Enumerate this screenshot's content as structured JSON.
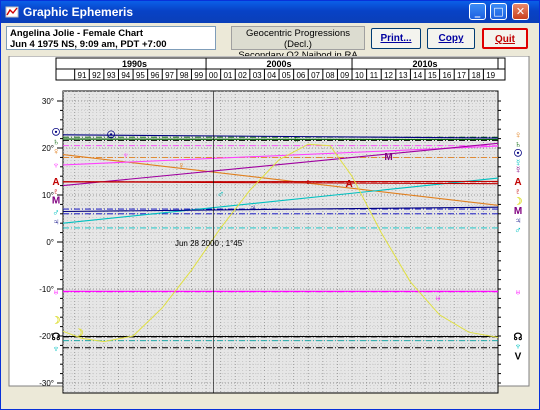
{
  "window": {
    "title": "Graphic Ephemeris"
  },
  "chart_info": {
    "line1": "Angelina Jolie - Female Chart",
    "line2": "Jun 4 1975 NS, 9:09 am, PDT +7:00"
  },
  "method": {
    "line1": "Geocentric Progressions (Decl.)",
    "line2": "Secondary Q2 Naibod in RA"
  },
  "buttons": {
    "print": "Print...",
    "copy": "Copy",
    "quit": "Quit"
  },
  "nav": {
    "prev": "<<",
    "next": ">>"
  },
  "decades": [
    "1990s",
    "2000s",
    "2010s"
  ],
  "years": [
    "91",
    "92",
    "93",
    "94",
    "95",
    "96",
    "97",
    "98",
    "99",
    "00",
    "01",
    "02",
    "03",
    "04",
    "05",
    "06",
    "07",
    "08",
    "09",
    "10",
    "11",
    "12",
    "13",
    "14",
    "15",
    "16",
    "17",
    "18",
    "19"
  ],
  "y_ticks": [
    "30°",
    "20°",
    "10°",
    "0°",
    "-10°",
    "-20°",
    "-30°"
  ],
  "cursor_label": "Jun 28 2000 ;  1°45'",
  "chart_data": {
    "type": "line",
    "ylim": [
      -30,
      30
    ],
    "x_range": [
      1990.2,
      2020.0
    ],
    "series": [
      {
        "name": "Sun",
        "color": "#000080",
        "points": [
          [
            1990.2,
            22.8
          ],
          [
            2020,
            22.1
          ]
        ]
      },
      {
        "name": "Saturn",
        "color": "#006000",
        "points": [
          [
            1990.2,
            21.9
          ],
          [
            2020,
            21.8
          ]
        ]
      },
      {
        "name": "Venus",
        "color": "#e08020",
        "points": [
          [
            1990.2,
            18.6
          ],
          [
            2020,
            7.8
          ]
        ]
      },
      {
        "name": "Neptune",
        "color": "#ff40ff",
        "points": [
          [
            1990.2,
            16.4
          ],
          [
            2020,
            20.4
          ]
        ]
      },
      {
        "name": "Mercury",
        "color": "#a000a0",
        "points": [
          [
            1990.2,
            12.0
          ],
          [
            2020,
            21.0
          ]
        ]
      },
      {
        "name": "Mars",
        "color": "#00c0c0",
        "points": [
          [
            1990.2,
            4.0
          ],
          [
            2020,
            13.6
          ]
        ]
      },
      {
        "name": "Ascendant",
        "color": "#c00000",
        "points": [
          [
            1990.2,
            12.8
          ],
          [
            2020,
            12.4
          ]
        ]
      },
      {
        "name": "Pluto",
        "color": "#c00000",
        "points": [
          [
            1990.2,
            12.8
          ],
          [
            2020,
            12.9
          ]
        ]
      },
      {
        "name": "Jupiter",
        "color": "#000080",
        "points": [
          [
            1990.2,
            6.5
          ],
          [
            2020,
            7.4
          ]
        ]
      },
      {
        "name": "Uranus",
        "color": "#ff00ff",
        "points": [
          [
            1990.2,
            -10.5
          ],
          [
            2020,
            -10.5
          ]
        ]
      },
      {
        "name": "Node",
        "color": "#000000",
        "points": [
          [
            1990.2,
            -20.1
          ],
          [
            2020,
            -20.1
          ]
        ]
      },
      {
        "name": "Moon",
        "color": "#e0e040",
        "points": [
          [
            1990.2,
            -19.0
          ],
          [
            1991.5,
            -20.5
          ],
          [
            1993,
            -21.2
          ],
          [
            1995,
            -20.0
          ],
          [
            1997,
            -14.0
          ],
          [
            1999,
            -6.0
          ],
          [
            2001,
            3.0
          ],
          [
            2003,
            11.0
          ],
          [
            2005,
            17.5
          ],
          [
            2007,
            20.8
          ],
          [
            2008.5,
            20.5
          ],
          [
            2010,
            14.0
          ],
          [
            2012,
            2.0
          ],
          [
            2014,
            -8.5
          ],
          [
            2016,
            -15.5
          ],
          [
            2018,
            -19.2
          ],
          [
            2020,
            -20.3
          ]
        ]
      }
    ]
  },
  "left_glyphs": [
    {
      "glyph": "☉",
      "color": "#000080",
      "y": 23.5
    },
    {
      "glyph": "♄",
      "color": "#006000",
      "y": 21.5
    },
    {
      "glyph": "♀",
      "color": "#e08020",
      "y": 19.5
    },
    {
      "glyph": "♆",
      "color": "#ff40ff",
      "y": 16.5
    },
    {
      "glyph": "A",
      "color": "#c00000",
      "y": 13.0
    },
    {
      "glyph": "♇",
      "color": "#c00000",
      "y": 11.0
    },
    {
      "glyph": "M",
      "color": "#800080",
      "y": 9.0
    },
    {
      "glyph": "♂",
      "color": "#00c0c0",
      "y": 6.5
    },
    {
      "glyph": "♃",
      "color": "#000080",
      "y": 4.5
    },
    {
      "glyph": "♅",
      "color": "#ff00ff",
      "y": -10.5
    },
    {
      "glyph": "☽",
      "color": "#e0e040",
      "y": -16.5
    },
    {
      "glyph": "☊",
      "color": "#000000",
      "y": -20.0
    },
    {
      "glyph": "♆",
      "color": "#00c0c0",
      "y": -22.5
    }
  ],
  "right_glyphs": [
    {
      "glyph": "♀",
      "color": "#e08020",
      "y": 23.0
    },
    {
      "glyph": "♄",
      "color": "#006000",
      "y": 21.0
    },
    {
      "glyph": "☉",
      "color": "#000080",
      "y": 19.0
    },
    {
      "glyph": "☿",
      "color": "#00c0c0",
      "y": 17.0
    },
    {
      "glyph": "☿",
      "color": "#800080",
      "y": 15.5
    },
    {
      "glyph": "A",
      "color": "#c00000",
      "y": 13.0
    },
    {
      "glyph": "♇",
      "color": "#c00000",
      "y": 11.0
    },
    {
      "glyph": "☽",
      "color": "#e0e040",
      "y": 8.8
    },
    {
      "glyph": "M",
      "color": "#800080",
      "y": 6.8
    },
    {
      "glyph": "♃",
      "color": "#000080",
      "y": 4.8
    },
    {
      "glyph": "♂",
      "color": "#00c0c0",
      "y": 2.8
    },
    {
      "glyph": "♅",
      "color": "#ff00ff",
      "y": -10.5
    },
    {
      "glyph": "☊",
      "color": "#000000",
      "y": -20.0
    },
    {
      "glyph": "♆",
      "color": "#00c0c0",
      "y": -22.0
    },
    {
      "glyph": "V",
      "color": "#000000",
      "y": -24.2
    }
  ],
  "inline_glyphs": [
    {
      "glyph": "☉",
      "color": "#000080",
      "x": 1993.5,
      "y": 23.0
    },
    {
      "glyph": "♄",
      "color": "#006000",
      "y": 22.0,
      "x": 2006.2
    },
    {
      "glyph": "♆",
      "color": "#ff40ff",
      "x": 1994.5,
      "y": 18.6
    },
    {
      "glyph": "♀",
      "color": "#e08020",
      "x": 1998.3,
      "y": 16.5
    },
    {
      "glyph": "M",
      "color": "#800080",
      "x": 2012.5,
      "y": 18.3
    },
    {
      "glyph": "♇",
      "color": "#c00000",
      "x": 2007.0,
      "y": 13.0
    },
    {
      "glyph": "A",
      "color": "#c00000",
      "x": 2009.8,
      "y": 12.6
    },
    {
      "glyph": "♂",
      "color": "#00c0c0",
      "x": 2001.0,
      "y": 10.4
    },
    {
      "glyph": "♃",
      "color": "#000080",
      "x": 2003.2,
      "y": 7.4
    },
    {
      "glyph": "♅",
      "color": "#ff00ff",
      "x": 2015.9,
      "y": -11.8
    },
    {
      "glyph": "☽",
      "color": "#e0e040",
      "x": 1991.3,
      "y": -19.2
    }
  ]
}
